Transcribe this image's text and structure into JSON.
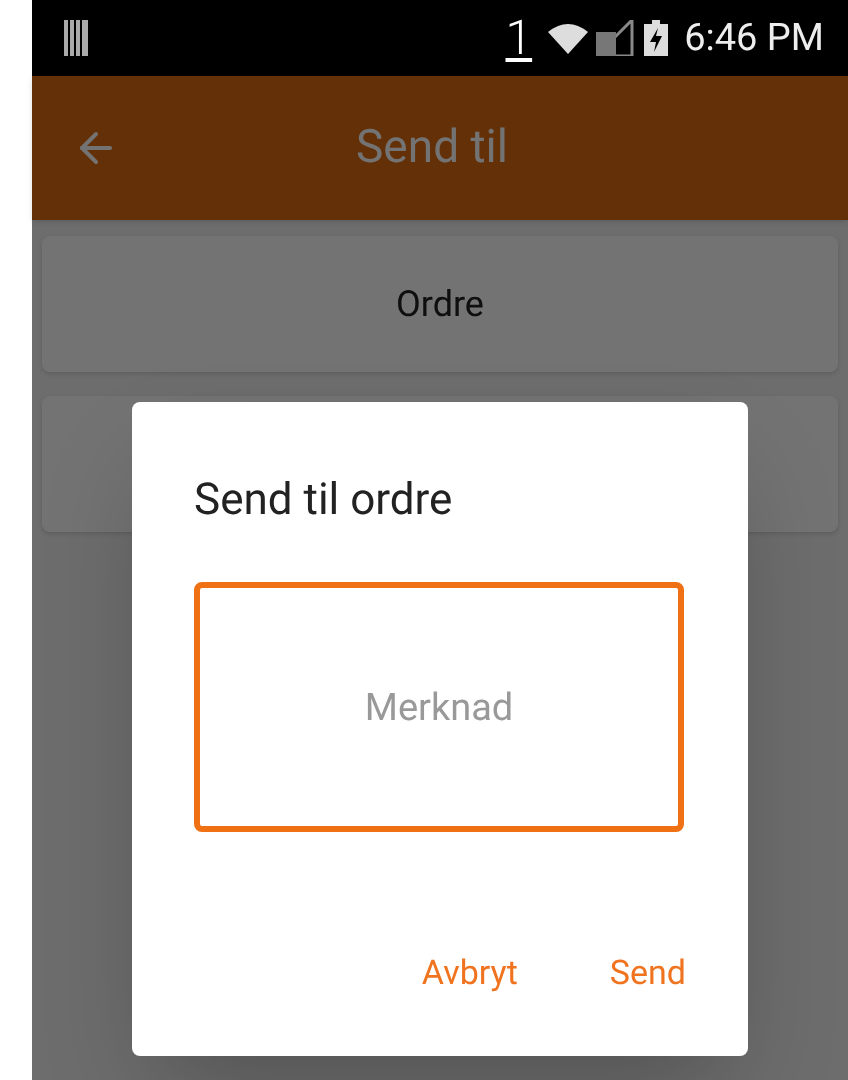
{
  "status_bar": {
    "notification_count": "1",
    "time": "6:46 PM"
  },
  "app_bar": {
    "title": "Send til"
  },
  "cards": [
    {
      "kind": "labelled",
      "label": "Ordre"
    },
    {
      "kind": "covered"
    }
  ],
  "dialog": {
    "title": "Send til ordre",
    "field": {
      "placeholder": "Merknad",
      "focused": true
    },
    "buttons": [
      {
        "label": "Avbryt"
      },
      {
        "label": "Send"
      }
    ]
  }
}
